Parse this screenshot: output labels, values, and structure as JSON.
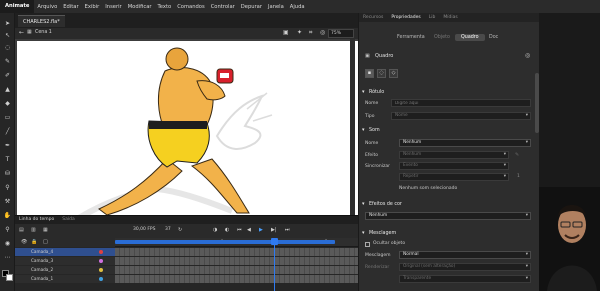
{
  "menubar": {
    "brand": "Animate",
    "items": [
      "Arquivo",
      "Editar",
      "Exibir",
      "Inserir",
      "Modificar",
      "Texto",
      "Comandos",
      "Controlar",
      "Depurar",
      "Janela",
      "Ajuda"
    ]
  },
  "document": {
    "tab_label": "CHARLES2.fla*",
    "scene_label": "Cena 1",
    "zoom": "75%"
  },
  "timeline": {
    "tabs": [
      "Linha do tempo",
      "Saída"
    ],
    "fps_value": "30,00",
    "fps_unit": "FPS",
    "frame_value": "37",
    "ruler_numbers": [
      "1s",
      "2s"
    ],
    "layers": [
      {
        "name": "Camada_4",
        "color": "#e04040"
      },
      {
        "name": "Camada_3",
        "color": "#d070e0"
      },
      {
        "name": "Camada_2",
        "color": "#e0c040"
      },
      {
        "name": "Camada_1",
        "color": "#40a0e0"
      }
    ]
  },
  "properties": {
    "tabs": [
      "Recursos",
      "Propriedades",
      "Lib",
      "Mídias"
    ],
    "active_tab": "Propriedades",
    "subtabs": [
      "Ferramenta",
      "Objeto",
      "Quadro",
      "Doc"
    ],
    "active_subtab": "Quadro",
    "panel_title": "Quadro",
    "label_section": {
      "title": "Rótulo",
      "name_label": "Nome",
      "name_placeholder": "Digite aqui",
      "type_label": "Tipo",
      "type_value": "Nome"
    },
    "sound_section": {
      "title": "Som",
      "name_label": "Nome",
      "name_value": "Nenhum",
      "effect_label": "Efeito",
      "effect_value": "Nenhum",
      "sync_label": "Sincronizar",
      "sync_value": "Evento",
      "repeat_value": "Repetir",
      "repeat_count": "1",
      "no_sound_text": "Nenhum som selecionado"
    },
    "color_effects_section": {
      "title": "Efeitos de cor",
      "value": "Nenhum"
    },
    "blend_section": {
      "title": "Mesclagem",
      "hide_object_label": "Ocultar objeto",
      "blend_label": "Mesclagem",
      "blend_value": "Normal",
      "render_label": "Renderizar",
      "render_value": "Original (sem alteração)",
      "transparent_value": "Transparente"
    }
  },
  "colors": {
    "accent": "#2f7af0",
    "skin": "#f2b24a",
    "shorts": "#f5d020",
    "glove": "#d8202c"
  }
}
